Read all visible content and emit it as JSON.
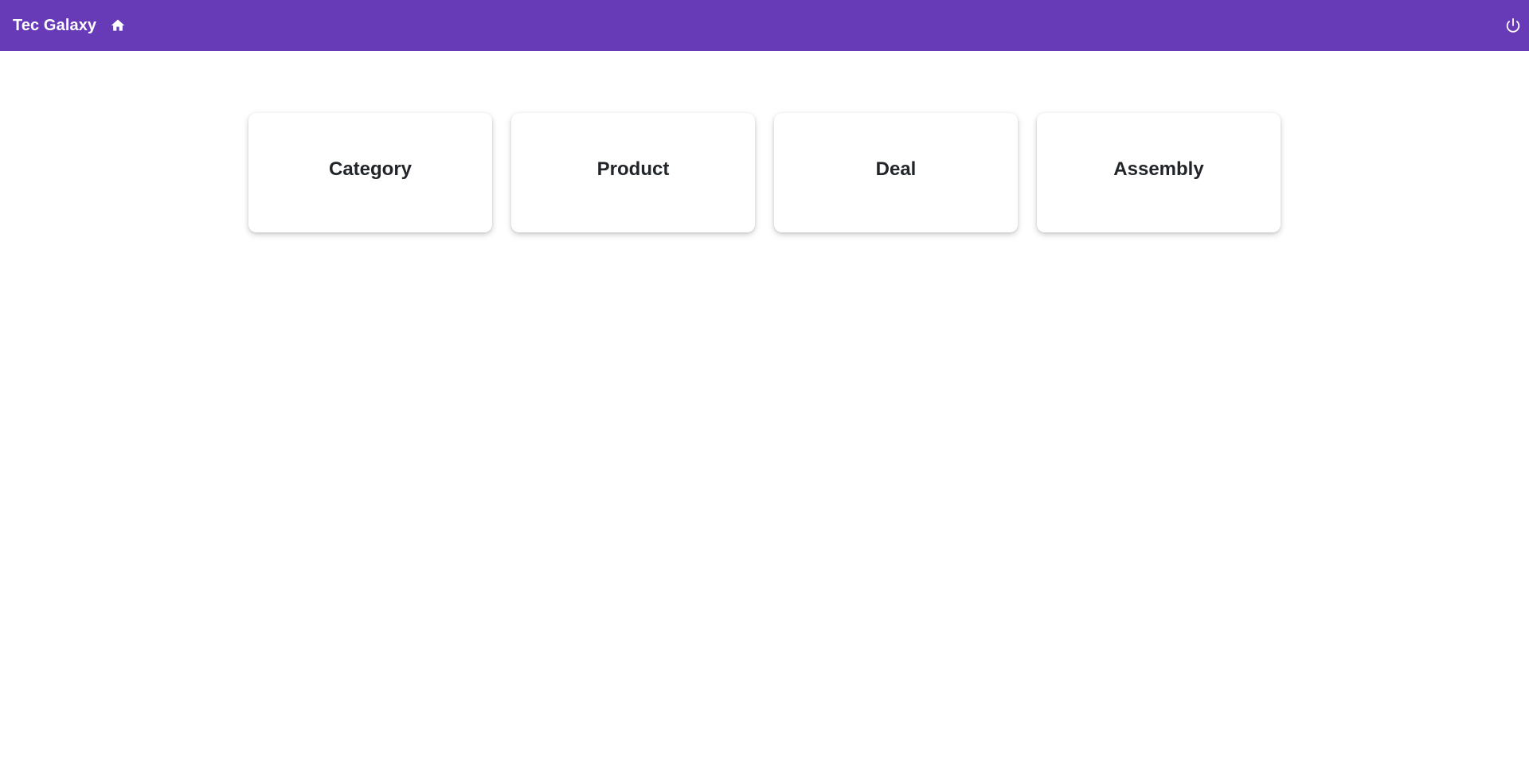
{
  "header": {
    "title": "Tec Galaxy",
    "home_icon": "home-icon",
    "power_icon": "power-icon",
    "background": "#673ab7"
  },
  "dashboard": {
    "cards": [
      {
        "label": "Category"
      },
      {
        "label": "Product"
      },
      {
        "label": "Deal"
      },
      {
        "label": "Assembly"
      }
    ]
  }
}
